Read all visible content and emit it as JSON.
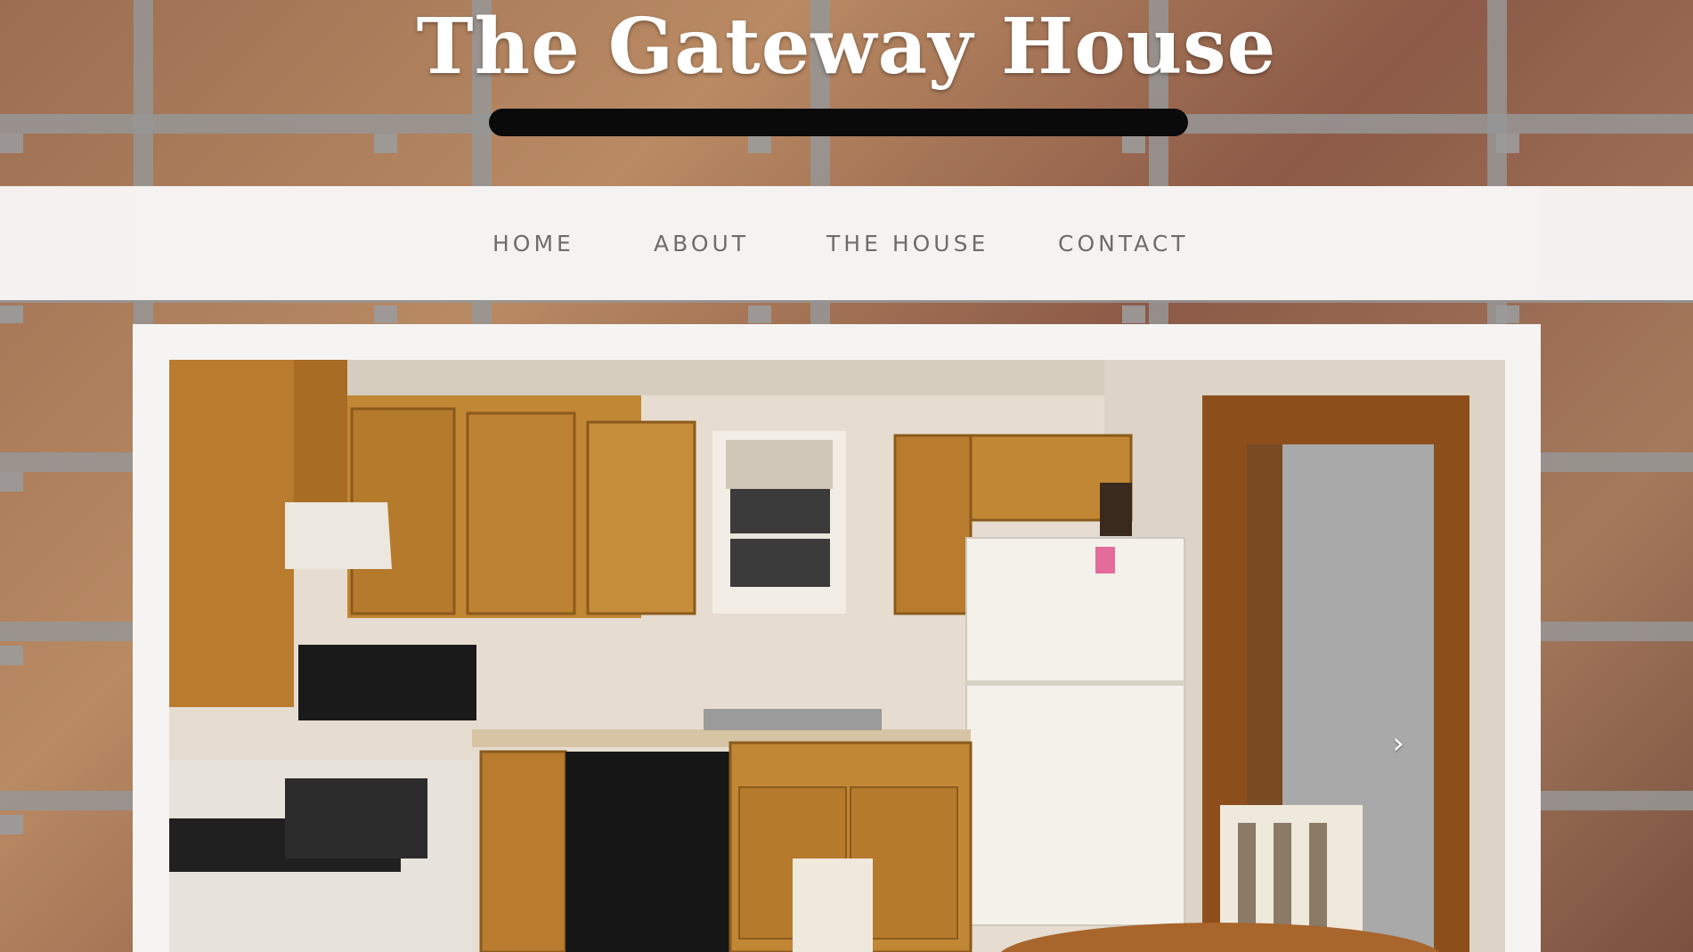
{
  "header": {
    "site_title": "The Gateway House"
  },
  "nav": {
    "items": [
      {
        "label": "HOME"
      },
      {
        "label": "ABOUT"
      },
      {
        "label": "THE HOUSE"
      },
      {
        "label": "CONTACT"
      }
    ]
  },
  "slider": {
    "next_arrow": "›",
    "current_image_alt": "kitchen-photo"
  },
  "colors": {
    "nav_text": "#6d6d6d",
    "title_text": "#ffffff",
    "underline_bar": "#0a0a0a",
    "panel_bg": "#f6f4f3"
  }
}
